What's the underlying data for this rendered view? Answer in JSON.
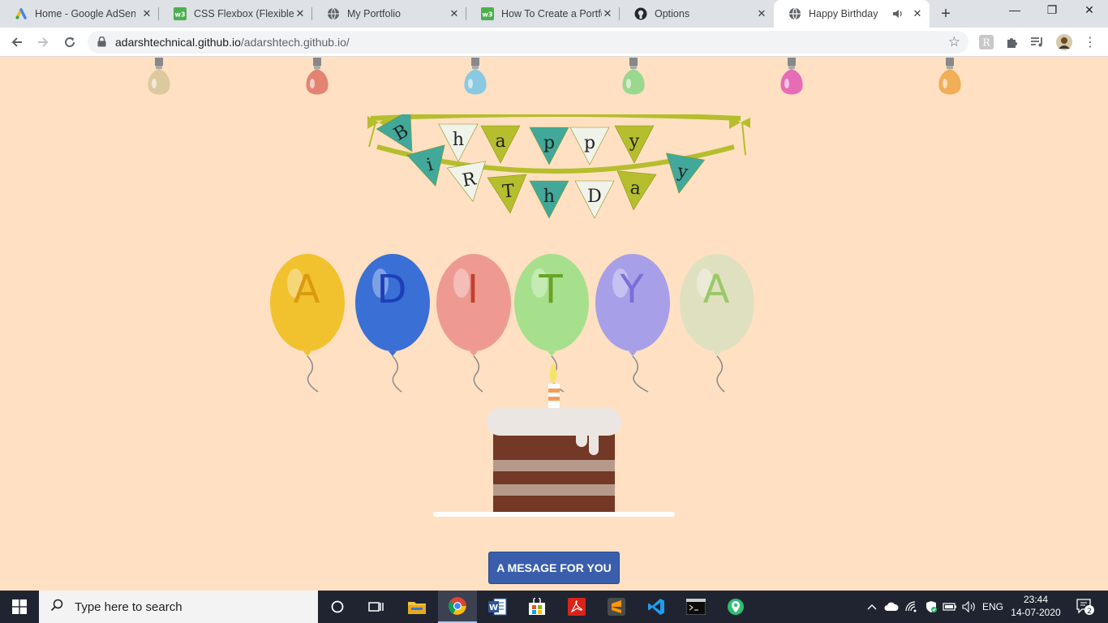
{
  "browser": {
    "tabs": [
      {
        "title": "Home - Google AdSense",
        "favicon": "adsense-icon"
      },
      {
        "title": "CSS Flexbox (Flexible Box)",
        "favicon": "w3schools-icon"
      },
      {
        "title": "My Portfolio",
        "favicon": "globe-icon"
      },
      {
        "title": "How To Create a Portfolio",
        "favicon": "w3schools-icon"
      },
      {
        "title": "Options",
        "favicon": "github-icon"
      },
      {
        "title": "Happy Birthday",
        "favicon": "globe-icon",
        "active": true,
        "audio": true
      }
    ],
    "url_host": "adarshtechnical.github.io",
    "url_path": "/adarshtech.github.io/"
  },
  "page": {
    "banner_row1": [
      "B",
      "h",
      "a",
      "p",
      "p",
      "y"
    ],
    "banner_row2": [
      "i",
      "R",
      "T",
      "h",
      "D",
      "a",
      "y"
    ],
    "bulb_colors": [
      "#d9c79a",
      "#e07a6a",
      "#7cc6e6",
      "#8fd68a",
      "#e35fb4",
      "#f0a84a"
    ],
    "balloons": [
      {
        "letter": "A",
        "color": "#f2c12e",
        "letter_color": "#d99a12"
      },
      {
        "letter": "D",
        "color": "#3a6fd6",
        "letter_color": "#1d3fb8"
      },
      {
        "letter": "I",
        "color": "#ee9a92",
        "letter_color": "#c2412e"
      },
      {
        "letter": "T",
        "color": "#a6e08c",
        "letter_color": "#6aa224"
      },
      {
        "letter": "Y",
        "color": "#a7a0e8",
        "letter_color": "#7a6fd8"
      },
      {
        "letter": "A",
        "color": "#dfe0c0",
        "letter_color": "#9ac86a"
      }
    ],
    "button_label": "A MESAGE FOR YOU"
  },
  "taskbar": {
    "search_placeholder": "Type here to search",
    "language": "ENG",
    "time": "23:44",
    "date": "14-07-2020",
    "notification_count": "2"
  }
}
